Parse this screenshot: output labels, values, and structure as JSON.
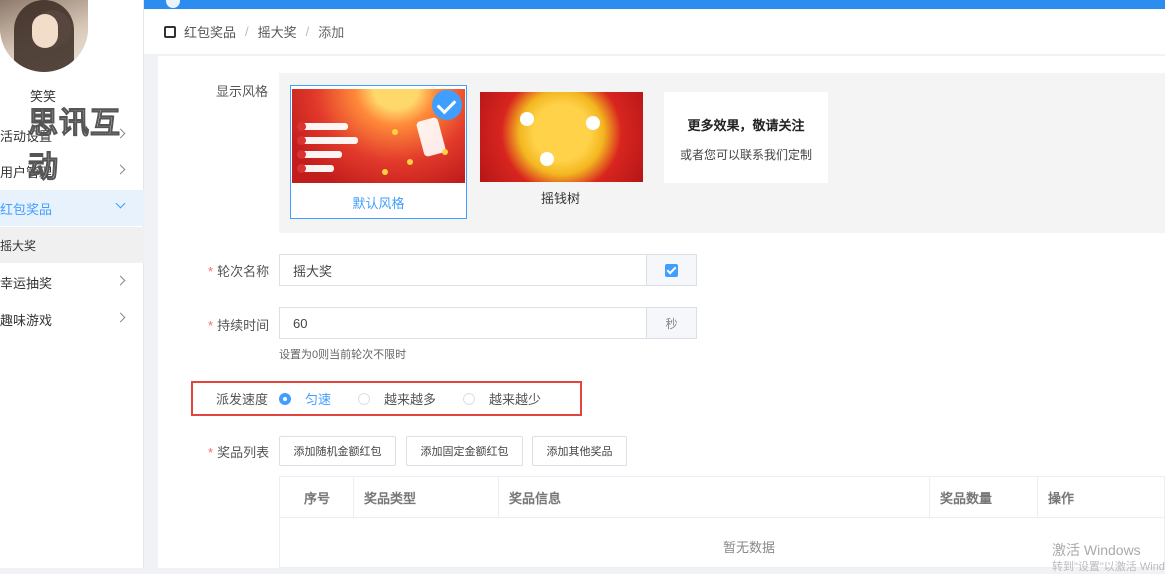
{
  "user": {
    "name": "笑笑"
  },
  "watermark": "思讯互动",
  "sidebar": {
    "items": [
      {
        "label": "活动设置"
      },
      {
        "label": "用户管理"
      },
      {
        "label": "红包奖品"
      },
      {
        "label": "摇大奖"
      },
      {
        "label": "幸运抽奖"
      },
      {
        "label": "趣味游戏"
      }
    ]
  },
  "breadcrumb": [
    "红包奖品",
    "摇大奖",
    "添加"
  ],
  "form": {
    "style_label": "显示风格",
    "styles": [
      {
        "name": "默认风格",
        "selected": true
      },
      {
        "name": "摇钱树",
        "selected": false
      }
    ],
    "more": {
      "title": "更多效果，敬请关注",
      "subtitle": "或者您可以联系我们定制"
    },
    "round_name_label": "轮次名称",
    "round_name_value": "摇大奖",
    "round_name_checked": true,
    "duration_label": "持续时间",
    "duration_value": "60",
    "duration_unit": "秒",
    "duration_hint": "设置为0则当前轮次不限时",
    "speed_label": "派发速度",
    "speed_options": [
      "匀速",
      "越来越多",
      "越来越少"
    ],
    "speed_selected": "匀速",
    "prizes_label": "奖品列表",
    "buttons": [
      "添加随机金额红包",
      "添加固定金额红包",
      "添加其他奖品"
    ],
    "table_headers": [
      "序号",
      "奖品类型",
      "奖品信息",
      "奖品数量",
      "操作"
    ],
    "empty_text": "暂无数据"
  },
  "windows_watermark": {
    "line1": "激活 Windows",
    "line2": "转到\"设置\"以激活 Windows"
  },
  "colors": {
    "accent": "#409eff",
    "topbar": "#2d8cf0",
    "required": "#f56c6c",
    "highlight": "#e0453f"
  }
}
